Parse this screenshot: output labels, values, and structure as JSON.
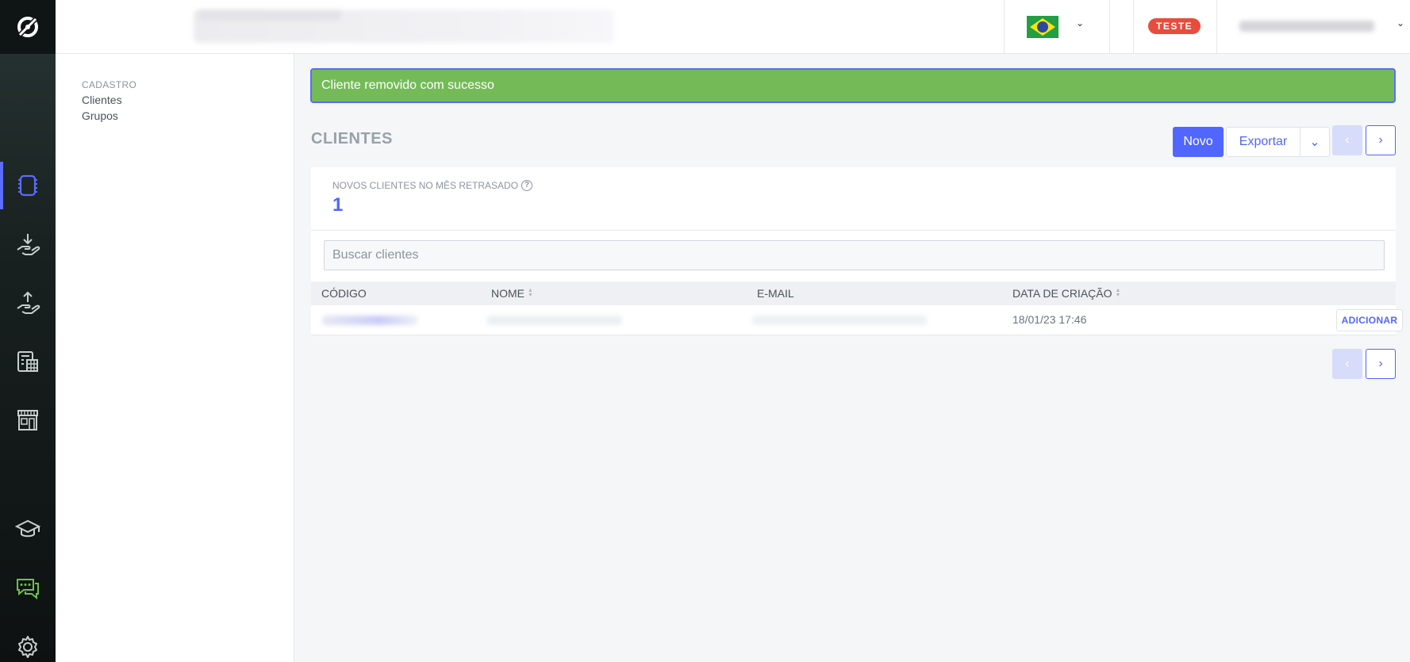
{
  "header": {
    "tenant_badge": "TESTE",
    "language_chevron": "⌄",
    "user_chevron": "⌄"
  },
  "subnav": {
    "section_title": "CADASTRO",
    "items": [
      {
        "label": "Clientes"
      },
      {
        "label": "Grupos"
      }
    ]
  },
  "alert": {
    "message": "Cliente removido com sucesso"
  },
  "page": {
    "title": "CLIENTES"
  },
  "toolbar": {
    "new_label": "Novo",
    "export_label": "Exportar",
    "export_caret": "⌄",
    "prev_label": "‹",
    "next_label": "›"
  },
  "stats": {
    "label": "NOVOS CLIENTES NO MÊS RETRASADO",
    "help": "?",
    "value": "1"
  },
  "search": {
    "placeholder": "Buscar clientes"
  },
  "table": {
    "columns": [
      "CÓDIGO",
      "NOME",
      "E-MAIL",
      "DATA DE CRIAÇÃO"
    ],
    "rows": [
      {
        "created_at": "18/01/23 17:46",
        "action": "ADICIONAR"
      }
    ]
  },
  "pagination_bottom": {
    "prev_label": "‹",
    "next_label": "›"
  },
  "colors": {
    "accent": "#5166ff",
    "success": "#74bb58",
    "danger": "#e84c3d",
    "rail": "#0d1111"
  },
  "icons": {
    "rail": [
      "logo-icon",
      "register-icon",
      "receive-icon",
      "send-icon",
      "calculator-icon",
      "store-icon",
      "graduation-cap-icon",
      "chat-icon",
      "gear-icon"
    ]
  }
}
